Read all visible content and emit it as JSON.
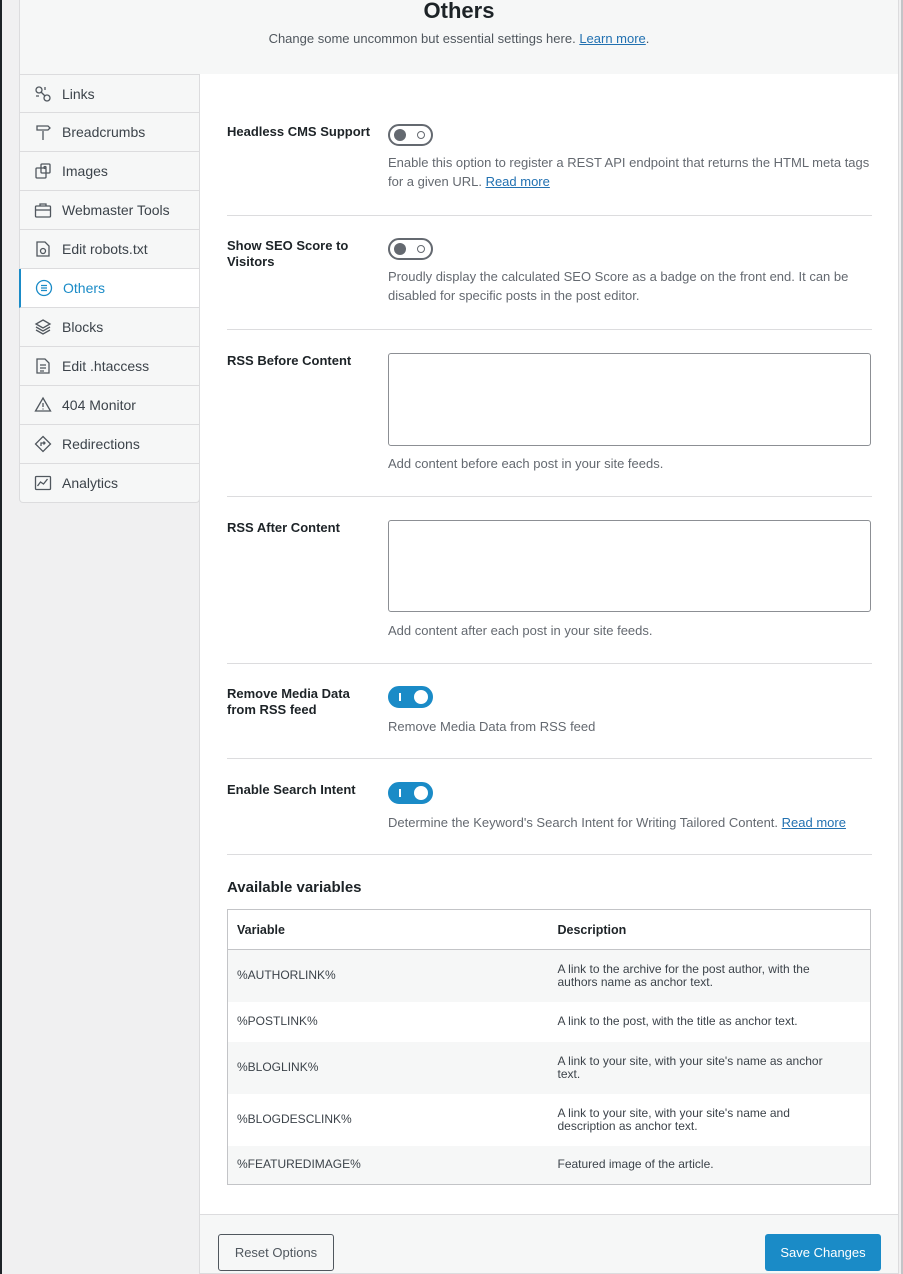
{
  "header": {
    "title": "Others",
    "subtitle": "Change some uncommon but essential settings here.",
    "learn_more": "Learn more"
  },
  "sidebar": {
    "items": [
      {
        "label": "Links",
        "icon": "link-icon"
      },
      {
        "label": "Breadcrumbs",
        "icon": "signpost-icon"
      },
      {
        "label": "Images",
        "icon": "images-icon"
      },
      {
        "label": "Webmaster Tools",
        "icon": "toolbox-icon"
      },
      {
        "label": "Edit robots.txt",
        "icon": "robot-file-icon"
      },
      {
        "label": "Others",
        "icon": "list-circle-icon",
        "active": true
      },
      {
        "label": "Blocks",
        "icon": "blocks-icon"
      },
      {
        "label": "Edit .htaccess",
        "icon": "file-text-icon"
      },
      {
        "label": "404 Monitor",
        "icon": "warning-icon"
      },
      {
        "label": "Redirections",
        "icon": "redirect-icon"
      },
      {
        "label": "Analytics",
        "icon": "analytics-icon"
      }
    ]
  },
  "settings": {
    "headless": {
      "label": "Headless CMS Support",
      "enabled": false,
      "desc": "Enable this option to register a REST API endpoint that returns the HTML meta tags for a given URL.",
      "read_more": "Read more"
    },
    "seo_score": {
      "label": "Show SEO Score to Visitors",
      "enabled": false,
      "desc": "Proudly display the calculated SEO Score as a badge on the front end. It can be disabled for specific posts in the post editor."
    },
    "rss_before": {
      "label": "RSS Before Content",
      "value": "",
      "desc": "Add content before each post in your site feeds."
    },
    "rss_after": {
      "label": "RSS After Content",
      "value": "",
      "desc": "Add content after each post in your site feeds."
    },
    "remove_media": {
      "label": "Remove Media Data from RSS feed",
      "enabled": true,
      "desc": "Remove Media Data from RSS feed"
    },
    "search_intent": {
      "label": "Enable Search Intent",
      "enabled": true,
      "desc": "Determine the Keyword's Search Intent for Writing Tailored Content.",
      "read_more": "Read more"
    }
  },
  "variables": {
    "title": "Available variables",
    "columns": [
      "Variable",
      "Description"
    ],
    "rows": [
      [
        "%AUTHORLINK%",
        "A link to the archive for the post author, with the authors name as anchor text."
      ],
      [
        "%POSTLINK%",
        "A link to the post, with the title as anchor text."
      ],
      [
        "%BLOGLINK%",
        "A link to your site, with your site's name as anchor text."
      ],
      [
        "%BLOGDESCLINK%",
        "A link to your site, with your site's name and description as anchor text."
      ],
      [
        "%FEATUREDIMAGE%",
        "Featured image of the article."
      ]
    ]
  },
  "footer": {
    "reset_label": "Reset Options",
    "save_label": "Save Changes"
  },
  "colors": {
    "accent": "#1a8bc7",
    "toggle_off": "#646970"
  }
}
